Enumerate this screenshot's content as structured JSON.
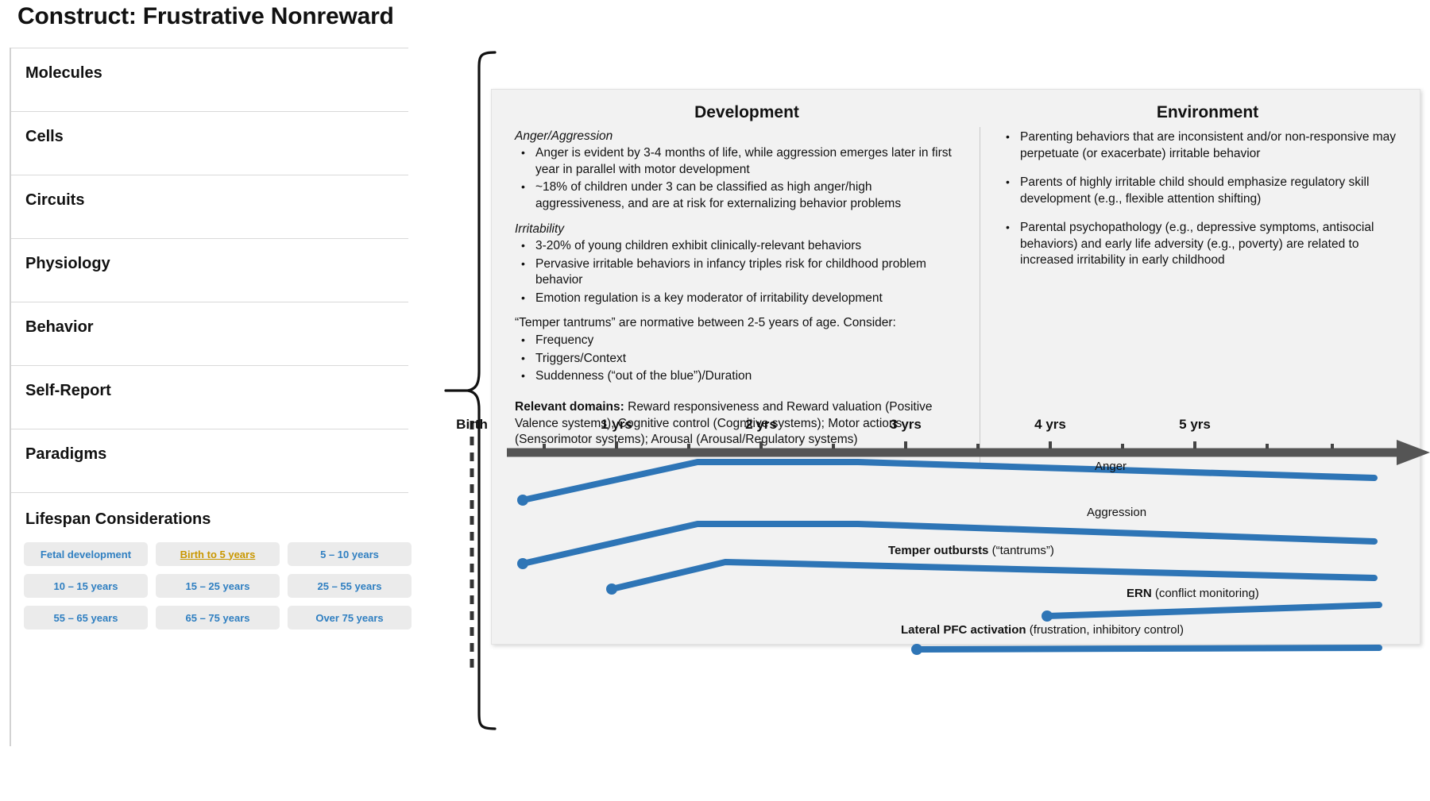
{
  "page": {
    "title": "Construct: Frustrative Nonreward"
  },
  "sidebar": {
    "rows": [
      {
        "label": "Molecules"
      },
      {
        "label": "Cells"
      },
      {
        "label": "Circuits"
      },
      {
        "label": "Physiology"
      },
      {
        "label": "Behavior"
      },
      {
        "label": "Self-Report"
      },
      {
        "label": "Paradigms"
      }
    ],
    "lifespan_title": "Lifespan Considerations",
    "chips": [
      {
        "label": "Fetal development",
        "selected": false
      },
      {
        "label": "Birth to 5 years",
        "selected": true
      },
      {
        "label": "5 – 10 years",
        "selected": false
      },
      {
        "label": "10 – 15 years",
        "selected": false
      },
      {
        "label": "15 – 25 years",
        "selected": false
      },
      {
        "label": "25 – 55 years",
        "selected": false
      },
      {
        "label": "55 – 65 years",
        "selected": false
      },
      {
        "label": "65 – 75 years",
        "selected": false
      },
      {
        "label": "Over 75 years",
        "selected": false
      }
    ]
  },
  "panel": {
    "development": {
      "heading": "Development",
      "sub1": "Anger/Aggression",
      "bullets1": [
        "Anger is evident by 3-4 months of life, while aggression emerges later in first year in parallel with motor development",
        "~18% of children under 3 can be classified as high anger/high aggressiveness, and are at risk for externalizing behavior problems"
      ],
      "sub2": "Irritability",
      "bullets2": [
        "3-20% of young children exhibit clinically-relevant behaviors",
        "Pervasive irritable behaviors in infancy triples risk for childhood problem behavior",
        "Emotion regulation is a key moderator of irritability development"
      ],
      "tantrum_intro": "“Temper tantrums” are normative between 2-5 years of age. Consider:",
      "bullets3": [
        "Frequency",
        "Triggers/Context",
        "Suddenness (“out of the blue”)/Duration"
      ],
      "domains_label": "Relevant domains:",
      "domains_text": " Reward responsiveness and Reward valuation (Positive Valence systems); Cognitive control (Cognitive systems); Motor actions (Sensorimotor systems); Arousal (Arousal/Regulatory systems)"
    },
    "environment": {
      "heading": "Environment",
      "bullets": [
        "Parenting behaviors that are inconsistent and/or non-responsive may perpetuate (or exacerbate) irritable behavior",
        "Parents of highly irritable child should emphasize regulatory skill development (e.g., flexible attention shifting)",
        "Parental psychopathology (e.g., depressive symptoms, antisocial behaviors) and early life adversity (e.g., poverty) are related to increased irritability in early childhood"
      ]
    }
  },
  "chart_data": {
    "type": "line",
    "title": "",
    "xlabel": "",
    "ylabel": "",
    "xlim": [
      0,
      5.5
    ],
    "grid": false,
    "legend": "inline-right",
    "axis_color": "#555555",
    "series_color": "#2E75B6",
    "birth_marker": {
      "label": "Birth",
      "x": 0,
      "style": "dashed-vertical"
    },
    "tick_labels": [
      "Birth",
      "1 yrs",
      "2 yrs",
      "3 yrs",
      "4 yrs",
      "5 yrs"
    ],
    "tick_values": [
      0,
      1,
      2,
      3,
      4,
      5
    ],
    "minor_tick_values": [
      0.5,
      1.5,
      2.5,
      3.5,
      4.5
    ],
    "series": [
      {
        "name": "Anger",
        "label_plain": "Anger",
        "label_bold": "",
        "start_dot": true,
        "x": [
          0.33,
          1.55,
          2.75,
          5.2
        ],
        "y": [
          0.22,
          0.55,
          0.55,
          0.4
        ]
      },
      {
        "name": "Aggression",
        "label_plain": "Aggression",
        "label_bold": "",
        "start_dot": true,
        "x": [
          0.33,
          1.55,
          2.75,
          5.2
        ],
        "y": [
          0.22,
          0.55,
          0.55,
          0.4
        ]
      },
      {
        "name": "Temper outbursts",
        "label_bold": "Temper outbursts",
        "label_plain": " (“tantrums”)",
        "start_dot": true,
        "x": [
          0.95,
          1.95,
          5.2
        ],
        "y": [
          0.1,
          0.55,
          0.42
        ]
      },
      {
        "name": "ERN",
        "label_bold": "ERN",
        "label_plain": " (conflict monitoring)",
        "start_dot": true,
        "x": [
          3.9,
          5.25
        ],
        "y": [
          0.2,
          0.55
        ]
      },
      {
        "name": "Lateral PFC activation",
        "label_bold": "Lateral PFC activation",
        "label_plain": " (frustration, inhibitory control)",
        "start_dot": true,
        "x": [
          2.95,
          5.25
        ],
        "y": [
          0.4,
          0.45
        ]
      }
    ]
  }
}
